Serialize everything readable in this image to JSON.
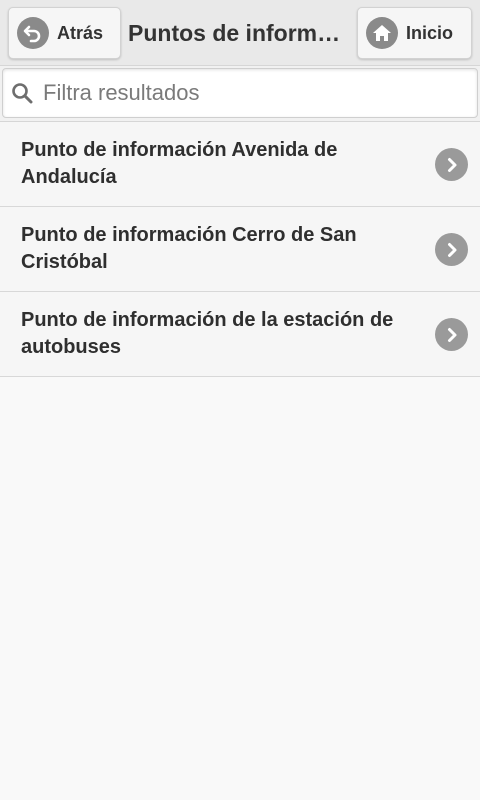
{
  "header": {
    "back_label": "Atrás",
    "title": "Puntos de información",
    "home_label": "Inicio"
  },
  "search": {
    "placeholder": "Filtra resultados",
    "value": ""
  },
  "list": {
    "items": [
      {
        "label": "Punto de información Avenida de Andalucía"
      },
      {
        "label": "Punto de información Cerro de San Cristóbal"
      },
      {
        "label": "Punto de información de la estación de autobuses"
      }
    ]
  },
  "icons": {
    "back": "back-arrow-icon",
    "home": "home-icon",
    "search": "search-icon",
    "chevron": "chevron-right-icon"
  }
}
